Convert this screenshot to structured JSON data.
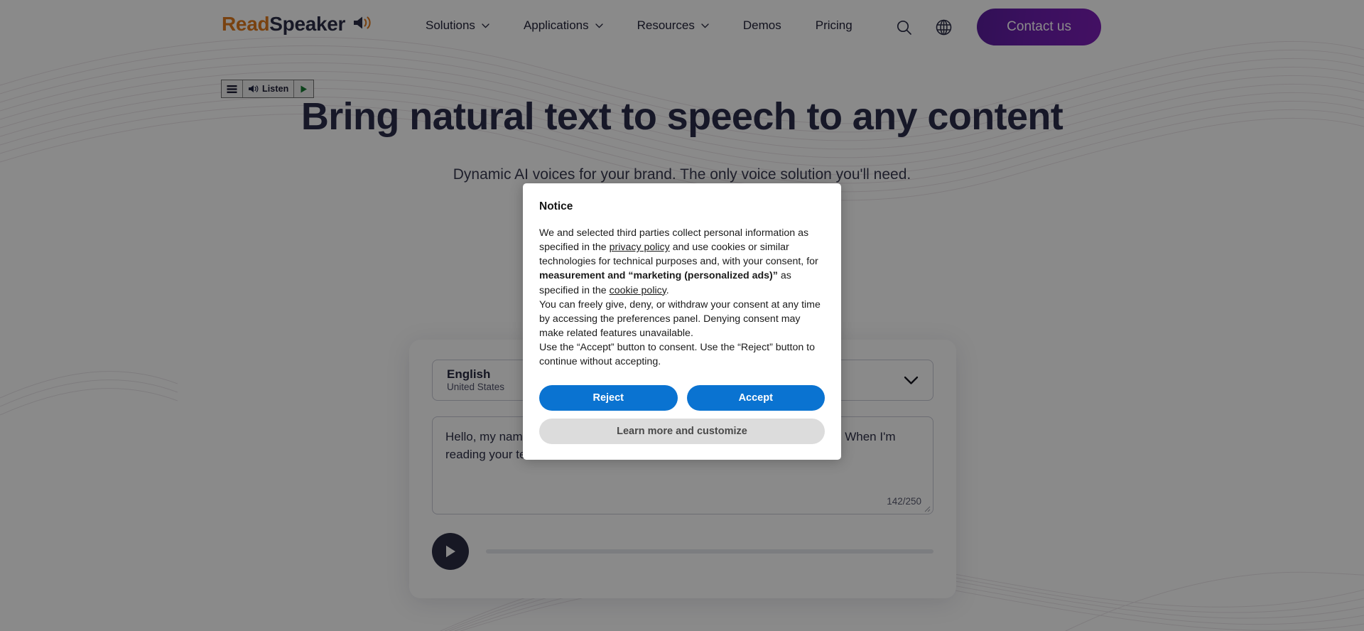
{
  "header": {
    "logo": {
      "part1": "Read",
      "part2": "Speaker",
      "icon": "speaker-icon"
    },
    "nav": [
      {
        "label": "Solutions",
        "has_dropdown": true
      },
      {
        "label": "Applications",
        "has_dropdown": true
      },
      {
        "label": "Resources",
        "has_dropdown": true
      },
      {
        "label": "Demos",
        "has_dropdown": false
      },
      {
        "label": "Pricing",
        "has_dropdown": false
      }
    ],
    "search_icon": "search-icon",
    "language_icon": "globe-icon",
    "contact_label": "Contact us"
  },
  "readspeaker_widget": {
    "menu_icon": "hamburger-menu-icon",
    "listen_label": "Listen",
    "speaker_icon": "speaker-icon",
    "play_icon": "play-triangle-icon"
  },
  "hero": {
    "title": "Bring natural text to speech to any content",
    "subtitle": "Dynamic AI voices for your brand. The only voice solution you'll need."
  },
  "demo": {
    "language": {
      "name": "English",
      "region": "United States"
    },
    "dropdown_icon": "chevron-down-icon",
    "text_value": "Hello, my name is Sophia and I am the voice you will enable your website. When I'm reading your text it sounds like this.",
    "char_count": "142/250",
    "play_icon": "play-icon",
    "progress_percent": 0
  },
  "dialog": {
    "title": "Notice",
    "paragraph1_a": "We and selected third parties collect personal information as specified in the ",
    "link_privacy": "privacy policy",
    "paragraph1_b": " and use cookies or similar technologies for technical purposes and, with your consent, for ",
    "bold_measurement": "measurement and “marketing (personalized ads)”",
    "paragraph1_c": " as specified in the ",
    "link_cookie": "cookie policy",
    "paragraph1_d": ".",
    "paragraph2": "You can freely give, deny, or withdraw your consent at any time by accessing the preferences panel. Denying consent may make related features unavailable.",
    "paragraph3": "Use the “Accept” button to consent. Use the “Reject” button to continue without accepting.",
    "reject_label": "Reject",
    "accept_label": "Accept",
    "learn_more_label": "Learn more and customize"
  },
  "colors": {
    "brand_orange": "#e07b1e",
    "brand_navy": "#2c2e47",
    "contact_purple": "#6b1fae",
    "dialog_blue": "#0a73d1",
    "dialog_gray": "#dcdcdc"
  }
}
